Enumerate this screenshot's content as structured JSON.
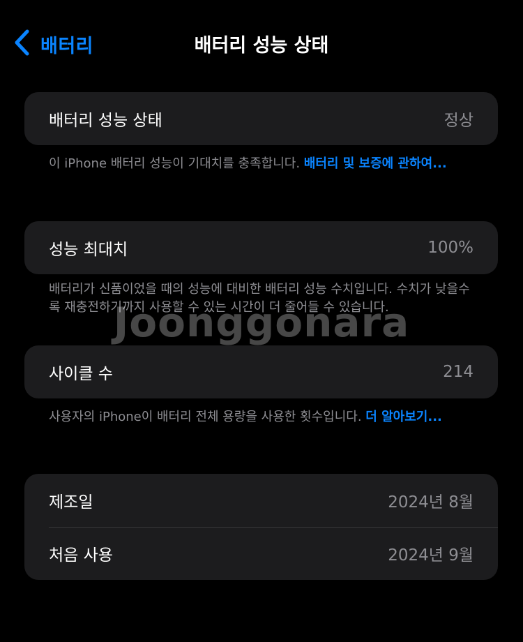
{
  "nav": {
    "back_label": "배터리",
    "title": "배터리 성능 상태"
  },
  "health": {
    "label": "배터리 성능 상태",
    "value": "정상",
    "footnote_text": "이 iPhone 배터리 성능이 기대치를 충족합니다. ",
    "footnote_link": "배터리 및 보증에 관하여..."
  },
  "max_capacity": {
    "label": "성능 최대치",
    "value": "100%",
    "footnote_text": "배터리가 신품이었을 때의 성능에 대비한 배터리 성능 수치입니다. 수치가 낮을수록 재충전하기까지 사용할 수 있는 시간이 더 줄어들 수 있습니다."
  },
  "cycle_count": {
    "label": "사이클 수",
    "value": "214",
    "footnote_text": "사용자의 iPhone이 배터리 전체 용량을 사용한 횟수입니다. ",
    "footnote_link": "더 알아보기..."
  },
  "dates": {
    "manufacture_label": "제조일",
    "manufacture_value": "2024년 8월",
    "first_use_label": "처음 사용",
    "first_use_value": "2024년 9월"
  },
  "watermark": "Joonggonara",
  "colors": {
    "accent": "#0a84ff",
    "background": "#000000",
    "card": "#1c1c1e",
    "secondary_text": "#8e8e93"
  },
  "icons": {
    "back": "chevron-left-icon"
  }
}
